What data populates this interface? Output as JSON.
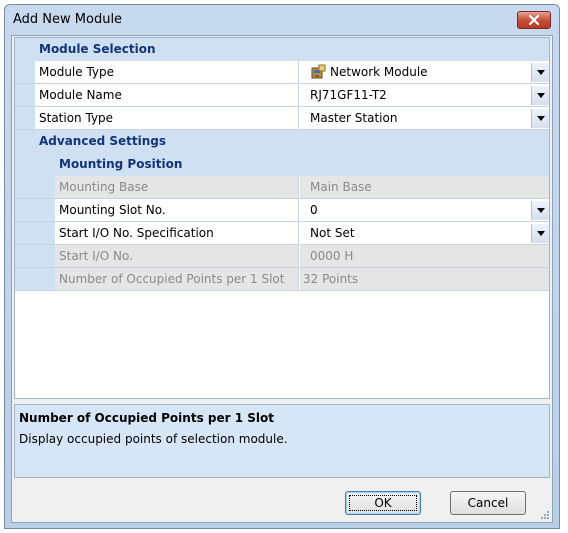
{
  "window": {
    "title": "Add New Module"
  },
  "sections": {
    "module_selection": "Module Selection",
    "advanced_settings": "Advanced Settings",
    "mounting_position": "Mounting Position"
  },
  "properties": {
    "module_type": {
      "label": "Module Type",
      "value": "Network Module",
      "icon": "network-module-icon"
    },
    "module_name": {
      "label": "Module Name",
      "value": "RJ71GF11-T2"
    },
    "station_type": {
      "label": "Station Type",
      "value": "Master Station"
    },
    "mounting_base": {
      "label": "Mounting Base",
      "value": "Main Base"
    },
    "mounting_slot": {
      "label": "Mounting Slot No.",
      "value": "0"
    },
    "start_io_spec": {
      "label": "Start I/O No. Specification",
      "value": "Not Set"
    },
    "start_io_no": {
      "label": "Start I/O No.",
      "value": "0000 H"
    },
    "occupied_points": {
      "label": "Number of Occupied Points per 1 Slot",
      "value": "32 Points"
    }
  },
  "help": {
    "title": "Number of Occupied Points per 1 Slot",
    "description": "Display occupied points of selection module."
  },
  "buttons": {
    "ok": "OK",
    "cancel": "Cancel"
  },
  "colors": {
    "section_bg": "#cfe0f3",
    "section_text": "#12357a",
    "disabled_bg": "#e5e5e5",
    "close_red": "#c8503b"
  }
}
